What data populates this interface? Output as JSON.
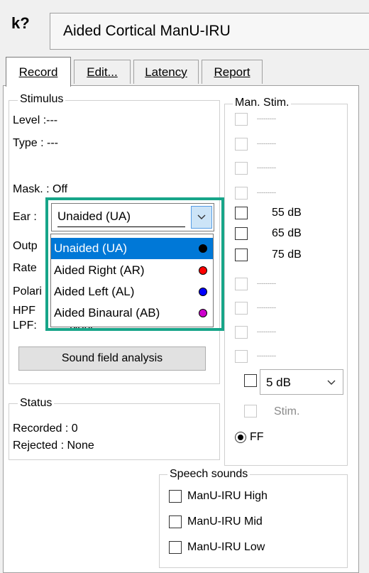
{
  "window": {
    "help_icon": "k?",
    "title": "Aided Cortical ManU-IRU"
  },
  "tabs": [
    {
      "label": "Record",
      "active": true
    },
    {
      "label": "Edit...",
      "active": false
    },
    {
      "label": "Latency",
      "active": false
    },
    {
      "label": "Report",
      "active": false
    }
  ],
  "stimulus": {
    "title": "Stimulus",
    "level": "Level :---",
    "type": "Type : ---",
    "mask": "Mask. : Off",
    "ear_label": "Ear :",
    "ear_value": "Unaided (UA)",
    "output_label": "Outp",
    "rate_label": "Rate",
    "polarity_label": "Polari",
    "hpf_label": "HPF",
    "lpf_label": "LPF:",
    "lpf_value": "None",
    "sound_field_button": "Sound field analysis"
  },
  "ear_dropdown": {
    "options": [
      {
        "label": "Unaided (UA)",
        "color": "#000000",
        "selected": true
      },
      {
        "label": "Aided Right (AR)",
        "color": "#ff0000",
        "selected": false
      },
      {
        "label": "Aided Left (AL)",
        "color": "#0000ff",
        "selected": false
      },
      {
        "label": "Aided Binaural (AB)",
        "color": "#cc00cc",
        "selected": false
      }
    ]
  },
  "man_stim": {
    "title": "Man. Stim.",
    "levels": [
      {
        "label": "---------",
        "enabled": false
      },
      {
        "label": "---------",
        "enabled": false
      },
      {
        "label": "---------",
        "enabled": false
      },
      {
        "label": "---------",
        "enabled": false
      },
      {
        "label": "55 dB",
        "enabled": true
      },
      {
        "label": "65 dB",
        "enabled": true
      },
      {
        "label": "75 dB",
        "enabled": true
      },
      {
        "label": "---------",
        "enabled": false
      },
      {
        "label": "---------",
        "enabled": false
      },
      {
        "label": "---------",
        "enabled": false
      },
      {
        "label": "---------",
        "enabled": false
      }
    ],
    "step_value": "5 dB",
    "stim_label": "Stim.",
    "ff_label": "FF"
  },
  "status": {
    "title": "Status",
    "recorded": "Recorded :  0",
    "rejected": "Rejected :   None"
  },
  "speech_sounds": {
    "title": "Speech sounds",
    "items": [
      "ManU-IRU High",
      "ManU-IRU Mid",
      "ManU-IRU Low"
    ]
  },
  "colors": {
    "accent_highlight": "#17a589",
    "selection": "#0078d7"
  }
}
